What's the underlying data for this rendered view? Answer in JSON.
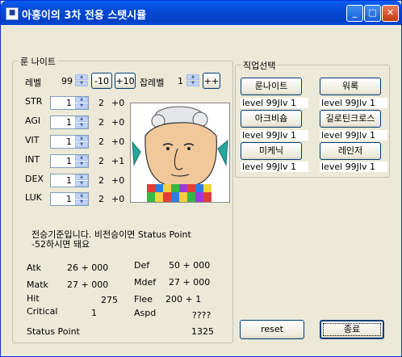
{
  "window": {
    "title": "아흥이의 3차 전용 스탯시뮬",
    "icon": "app-icon",
    "controls": {
      "minimize": "_",
      "maximize": "□",
      "close": "✕"
    }
  },
  "left_group": {
    "title": "룬 나이트",
    "level_label": "레벨",
    "level_value": "99",
    "minus10_label": "-10",
    "plus10_label": "+10",
    "job_level_label": "잡레벨",
    "job_level_value": "1",
    "job_plus_label": "++",
    "stats": [
      {
        "name": "STR",
        "value": "1",
        "cost": "2",
        "bonus": "+0"
      },
      {
        "name": "AGI",
        "value": "1",
        "cost": "2",
        "bonus": "+0"
      },
      {
        "name": "VIT",
        "value": "1",
        "cost": "2",
        "bonus": "+0"
      },
      {
        "name": "INT",
        "value": "1",
        "cost": "2",
        "bonus": "+1"
      },
      {
        "name": "DEX",
        "value": "1",
        "cost": "2",
        "bonus": "+0"
      },
      {
        "name": "LUK",
        "value": "1",
        "cost": "2",
        "bonus": "+0"
      }
    ],
    "notice_line1": "전승기준입니다. 비전승이면 Status Point",
    "notice_line2": "-52하시면 돼요",
    "derived": {
      "atk_label": "Atk",
      "atk_value": "26 + 000",
      "matk_label": "Matk",
      "matk_value": "27 + 000",
      "hit_label": "Hit",
      "hit_value": "275",
      "critical_label": "Critical",
      "critical_value": "1",
      "def_label": "Def",
      "def_value": "50 + 000",
      "mdef_label": "Mdef",
      "mdef_value": "27 + 000",
      "flee_label": "Flee",
      "flee_value": "200 + 1",
      "aspd_label": "Aspd",
      "aspd_value": "????",
      "status_point_label": "Status Point",
      "status_point_value": "1325"
    }
  },
  "right_group": {
    "title": "직업선택",
    "jobs": [
      {
        "name": "룬나이트",
        "level": "level 99Jlv 1"
      },
      {
        "name": "워록",
        "level": "level 99Jlv 1"
      },
      {
        "name": "아크비숍",
        "level": "level 99Jlv 1"
      },
      {
        "name": "길로틴크로스",
        "level": "level 99Jlv 1"
      },
      {
        "name": "미케닉",
        "level": "level 99Jlv 1"
      },
      {
        "name": "레인저",
        "level": "level 99Jlv 1"
      }
    ]
  },
  "buttons": {
    "reset_label": "reset",
    "exit_label": "종료"
  }
}
